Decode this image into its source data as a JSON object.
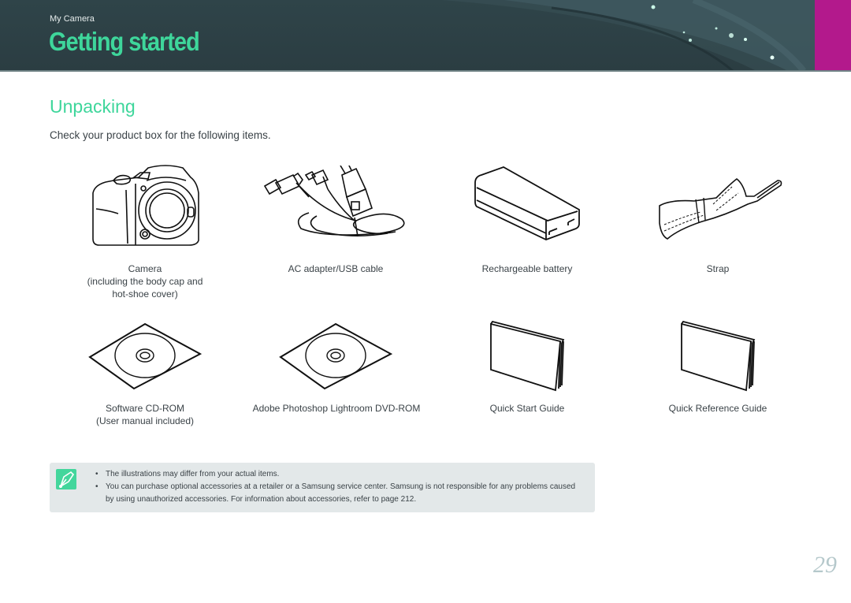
{
  "header": {
    "breadcrumb": "My Camera",
    "title": "Getting started",
    "accent_color": "#3ed69b",
    "tab_color": "#b3198c"
  },
  "section": {
    "title": "Unpacking",
    "intro": "Check your product box for the following items."
  },
  "items": [
    {
      "icon": "camera-icon",
      "lines": [
        "Camera",
        "(including the body cap and",
        "hot-shoe cover)"
      ]
    },
    {
      "icon": "ac-adapter-usb-cable-icon",
      "lines": [
        "AC adapter/USB cable"
      ]
    },
    {
      "icon": "battery-icon",
      "lines": [
        "Rechargeable battery"
      ]
    },
    {
      "icon": "strap-icon",
      "lines": [
        "Strap"
      ]
    },
    {
      "icon": "cd-rom-icon",
      "lines": [
        "Software CD-ROM",
        "(User manual included)"
      ]
    },
    {
      "icon": "dvd-rom-icon",
      "lines": [
        "Adobe Photoshop Lightroom DVD-ROM"
      ]
    },
    {
      "icon": "quick-start-guide-icon",
      "lines": [
        "Quick Start Guide"
      ]
    },
    {
      "icon": "quick-reference-guide-icon",
      "lines": [
        "Quick Reference Guide"
      ]
    }
  ],
  "note": {
    "icon": "note-pen-icon",
    "bullets": [
      "The illustrations may differ from your actual items.",
      "You can purchase optional accessories at a retailer or a Samsung service center. Samsung is not responsible for any problems caused by using unauthorized accessories. For information about accessories, refer to page 212."
    ]
  },
  "page_number": "29"
}
